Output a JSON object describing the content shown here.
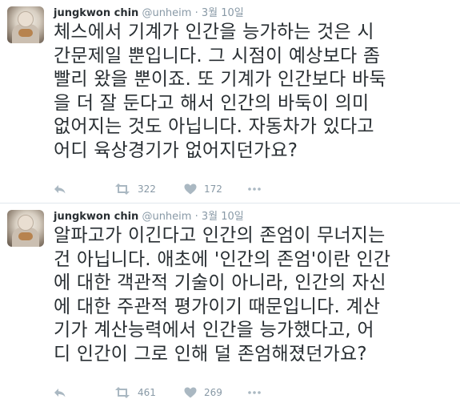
{
  "tweets": [
    {
      "name": "jungkwon chin",
      "handle": "@unheim",
      "separator": "·",
      "time": "3월 10일",
      "text": "체스에서 기계가 인간을 능가하는 것은 시\n간문제일 뿐입니다. 그 시점이 예상보다 좀\n빨리 왔을 뿐이죠. 또 기계가 인간보다 바둑\n을 더 잘 둔다고 해서 인간의 바둑이 의미\n없어지는 것도 아닙니다. 자동차가 있다고\n어디 육상경기가 없어지던가요?",
      "retweets": "322",
      "likes": "172",
      "icons": [
        "reply-icon",
        "retweet-icon",
        "like-icon",
        "more-icon"
      ]
    },
    {
      "name": "jungkwon chin",
      "handle": "@unheim",
      "separator": "·",
      "time": "3월 10일",
      "text": "알파고가 이긴다고 인간의 존엄이 무너지는\n건 아닙니다. 애초에 '인간의 존엄'이란 인간\n에 대한 객관적 기술이 아니라, 인간의 자신\n에 대한 주관적 평가이기 때문입니다. 계산\n기가 계산능력에서 인간을 능가했다고, 어\n디 인간이 그로 인해 덜 존엄해졌던가요?",
      "retweets": "461",
      "likes": "269",
      "icons": [
        "reply-icon",
        "retweet-icon",
        "like-icon",
        "more-icon"
      ]
    }
  ],
  "colors": {
    "text": "#292f33",
    "muted": "#8899a6",
    "divider": "#e1e8ed",
    "icon": "#aab8c2"
  }
}
